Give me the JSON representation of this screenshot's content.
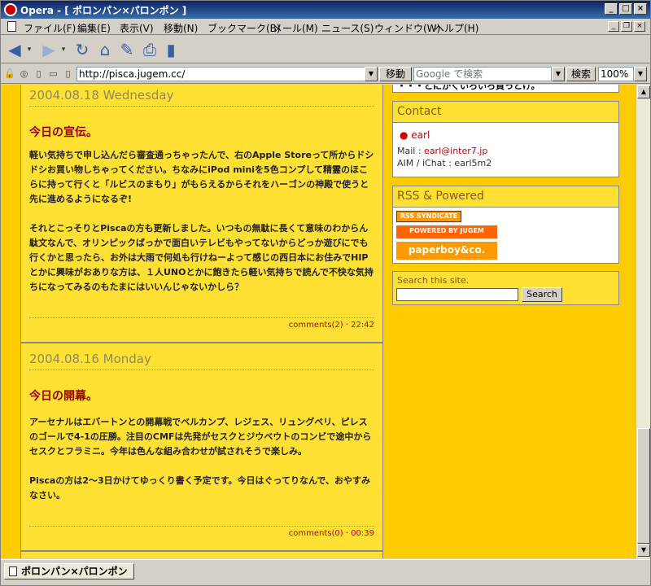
{
  "window": {
    "title": "Opera - [ ポロンパン×パロンポン ]"
  },
  "menu": {
    "items": [
      "ファイル(F)",
      "編集(E)",
      "表示(V)",
      "移動(N)",
      "ブックマーク(B)",
      "メール(M)",
      "ニュース(S)",
      "ウィンドウ(W)",
      "ヘルプ(H)"
    ]
  },
  "address": {
    "url": "http://pisca.jugem.cc/",
    "go_label": "移動",
    "search_placeholder": "Google で検索",
    "search_label": "検索",
    "zoom": "100%"
  },
  "entries": [
    {
      "date": "2004.08.18 Wednesday",
      "title": "今日の宣伝。",
      "paragraphs": [
        "軽い気持ちで申し込んだら審査通っちゃったんで、右のApple Storeって所からドシドシお買い物しちゃってください。ちなみにiPod miniを5色コンプして精霊のほこらに持って行くと「ルビスのまもり」がもらえるからそれをハーゴンの神殿で使うと先に進めるようになるぞ!",
        "それとこっそりとPiscaの方も更新しました。いつもの無駄に長くて意味のわからん駄文なんで、オリンピックばっかで面白いテレビもやってないからどっか遊びにでも行くかと思ったら、お外は大雨で何処も行けねーよって感じの西日本にお住みでHIPとかに興味がおありな方は、１人UNOとかに飽きたら軽い気持ちで読んで不快な気持ちになってみるのもたまにはいいんじゃないかしら？"
      ],
      "footer": "comments(2) · 22:42"
    },
    {
      "date": "2004.08.16 Monday",
      "title": "今日の開幕。",
      "paragraphs": [
        "アーセナルはエバートンとの開幕戦でベルカンプ、レジェス、リュングベリ、ピレスのゴールで4-1の圧勝。注目のCMFは先発がセスクとジウベウトのコンビで途中からセスクとフラミニ。今年は色んな組み合わせが試されそうで楽しみ。",
        "Piscaの方は2～3日かけてゆっくり書く予定です。今日はぐってりなんで、おやすみなさい。"
      ],
      "footer": "comments(0) · 00:39"
    }
  ],
  "sidebar": {
    "top_fragment": "・・・とにかくいろいろ買っとけ。",
    "contact": {
      "heading": "Contact",
      "name": "earl",
      "mail_label": "Mail : ",
      "mail": "earl@inter7.jp",
      "aim": "AIM / iChat : earl5m2"
    },
    "rss": {
      "heading": "RSS & Powered",
      "rss_badge": "RSS SYNDICATE",
      "jugem_badge": "POWERED BY JUGEM",
      "paperboy_badge": "paperboy&co."
    },
    "search": {
      "heading": "Search this site.",
      "button": "Search"
    }
  },
  "status": {
    "tab_title": "ポロンパン×パロンポン"
  }
}
